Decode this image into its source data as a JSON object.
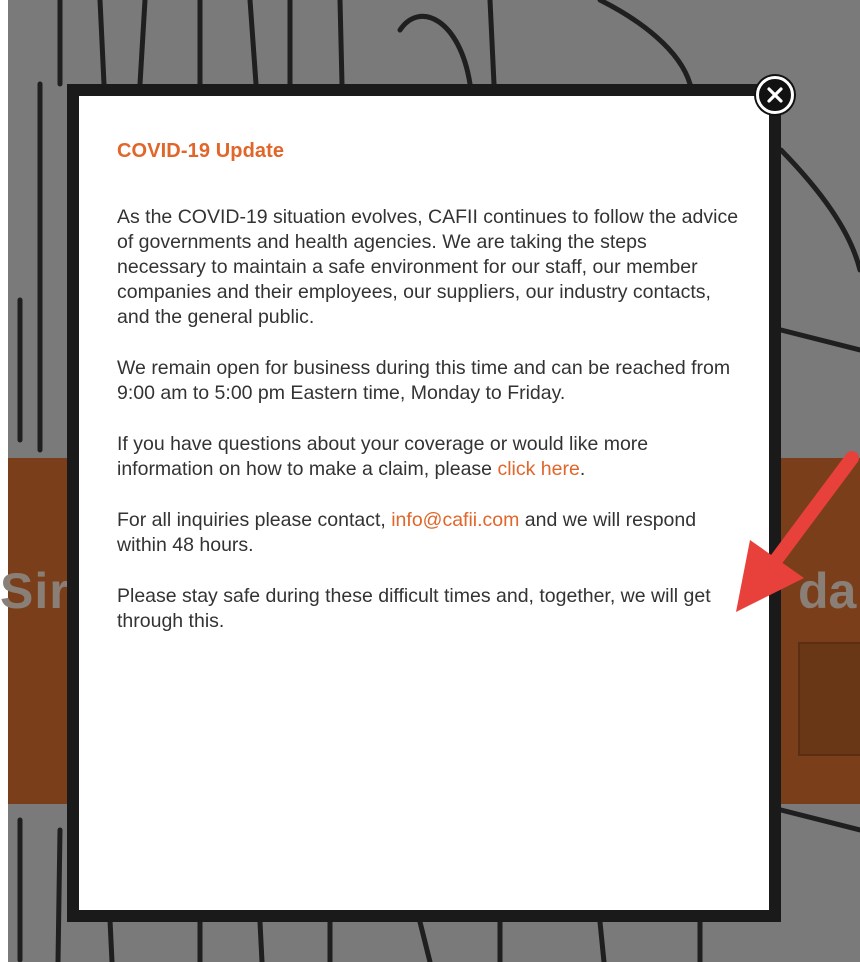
{
  "background": {
    "banner_left_text": "Sir",
    "banner_right_text": "da"
  },
  "modal": {
    "title": "COVID-19 Update",
    "paragraph1": "As the COVID-19 situation evolves, CAFII continues to follow the advice of governments and health agencies. We are taking the steps necessary to maintain a safe environment for our staff, our member companies and their employees, our suppliers, our industry contacts, and the general public.",
    "paragraph2": "We remain open for business during this time and can be reached from 9:00 am to 5:00 pm Eastern time, Monday to Friday.",
    "paragraph3_before_link": "If you have questions about your coverage or would like more information on how to make a claim, please ",
    "paragraph3_link": "click here",
    "paragraph3_after_link": ".",
    "paragraph4_before_link": "For all inquiries please contact, ",
    "paragraph4_link": "info@cafii.com",
    "paragraph4_after_link": " and we will respond within 48 hours.",
    "paragraph5": "Please stay safe during these difficult times and, together, we will get through this."
  },
  "colors": {
    "accent": "#e0662a",
    "text": "#333333",
    "arrow": "#e8403a"
  },
  "icons": {
    "close": "close-icon",
    "annotation": "arrow-icon"
  }
}
